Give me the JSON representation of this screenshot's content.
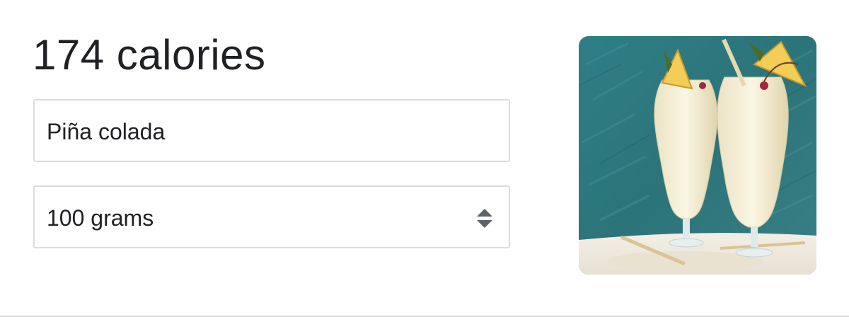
{
  "nutrition": {
    "calories_text": "174 calories",
    "food_input_value": "Piña colada",
    "amount_select_value": "100 grams"
  },
  "icons": {
    "stepper": "up-down-chevron-icon"
  },
  "colors": {
    "text": "#202124",
    "field_border": "#dcdcdc",
    "icon": "#5f6368",
    "photo_background": "#2f7f86",
    "divider": "#dadce0"
  }
}
